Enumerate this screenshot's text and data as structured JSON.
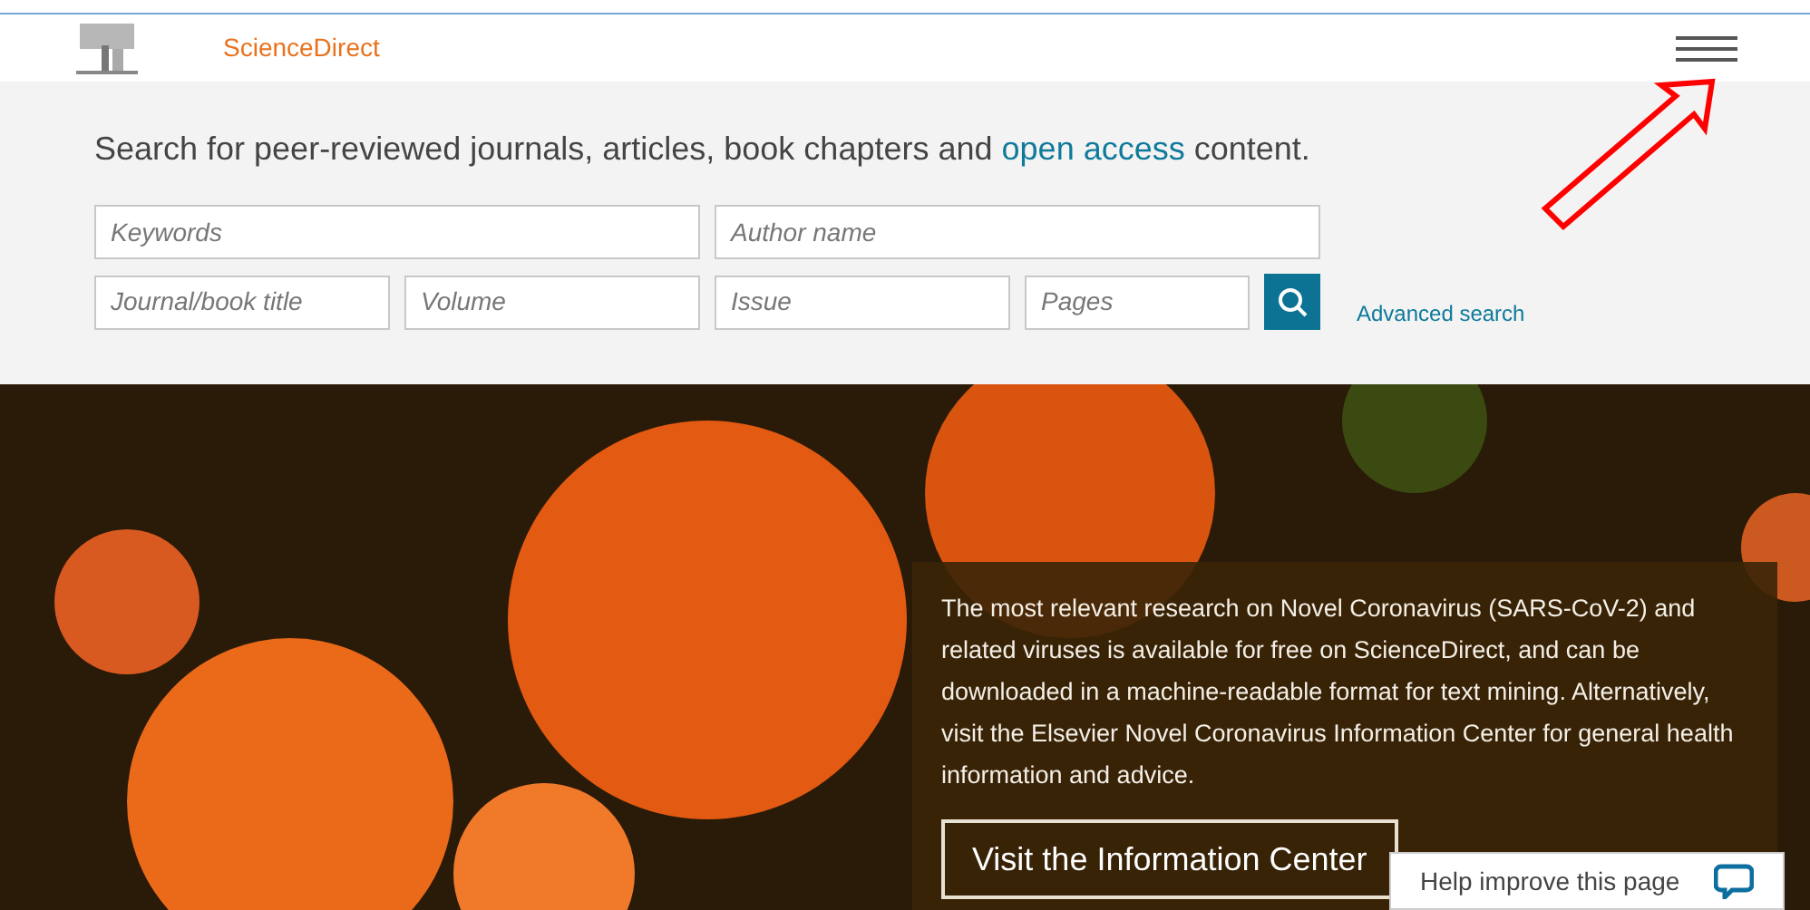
{
  "header": {
    "brand": "ScienceDirect"
  },
  "search": {
    "intro": "Search for peer-reviewed journals, articles, book chapters and",
    "intro_link": "open access",
    "intro_end": "content.",
    "fields_row_1": [
      {
        "placeholder": "Keywords"
      },
      {
        "placeholder": "Author name"
      }
    ],
    "fields_row_2": [
      {
        "placeholder": "Journal/book title"
      },
      {
        "placeholder": "Volume"
      },
      {
        "placeholder": "Issue"
      },
      {
        "placeholder": "Pages"
      }
    ],
    "advanced_link": "Advanced search"
  },
  "hero": {
    "message": "The most relevant research on Novel Coronavirus (SARS-CoV-2) and related viruses is available for free on ScienceDirect, and can be downloaded in a machine-readable format for text mining. Alternatively, visit the Elsevier Novel Coronavirus Information Center for general health information and advice.",
    "button": "Visit the Information Center"
  },
  "feedback": {
    "label": "Help improve this page"
  }
}
